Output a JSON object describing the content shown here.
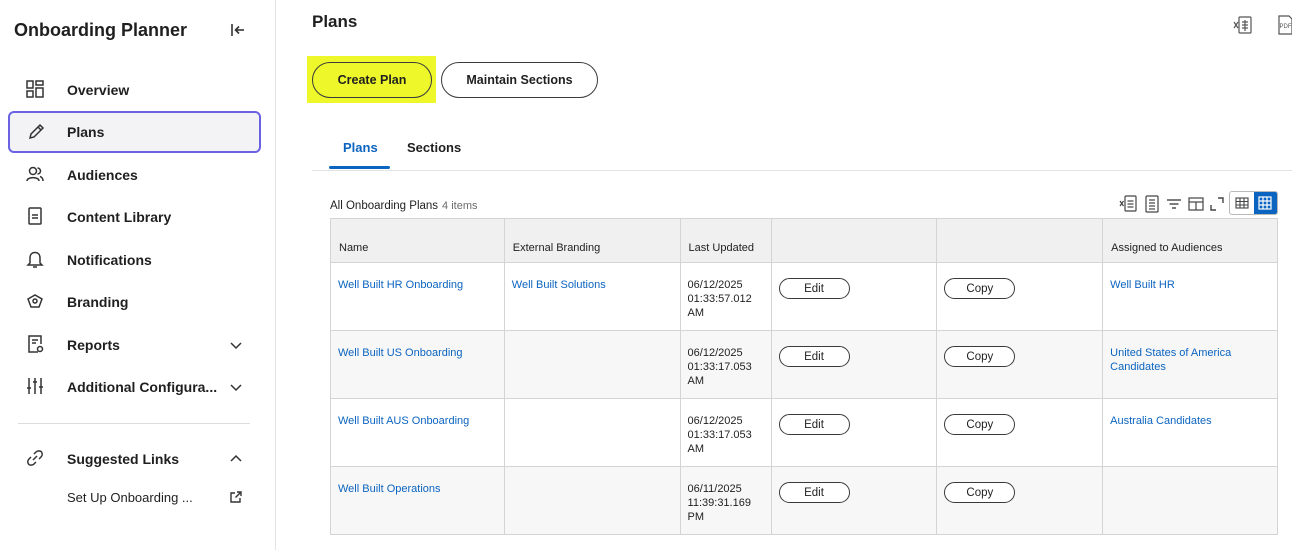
{
  "sidebar": {
    "title": "Onboarding Planner",
    "items": [
      {
        "label": "Overview",
        "icon": "grid-icon"
      },
      {
        "label": "Plans",
        "icon": "pencil-icon"
      },
      {
        "label": "Audiences",
        "icon": "people-icon"
      },
      {
        "label": "Content Library",
        "icon": "document-icon"
      },
      {
        "label": "Notifications",
        "icon": "bell-icon"
      },
      {
        "label": "Branding",
        "icon": "branding-icon"
      },
      {
        "label": "Reports",
        "icon": "report-icon"
      },
      {
        "label": "Additional Configura...",
        "icon": "sliders-icon"
      }
    ],
    "suggested_links": {
      "label": "Suggested Links",
      "items": [
        "Set Up Onboarding ..."
      ]
    }
  },
  "main": {
    "title": "Plans",
    "buttons": {
      "create": "Create Plan",
      "maintain": "Maintain Sections"
    },
    "tabs": [
      "Plans",
      "Sections"
    ],
    "active_tab": "Plans",
    "grid": {
      "caption": "All Onboarding Plans",
      "count": "4 items",
      "columns": [
        "Name",
        "External Branding",
        "Last Updated",
        "",
        "",
        "Assigned to Audiences"
      ],
      "edit_label": "Edit",
      "copy_label": "Copy",
      "rows": [
        {
          "name": "Well Built HR Onboarding",
          "branding": "Well Built Solutions",
          "updated_date": "06/12/2025",
          "updated_time": "01:33:57.012",
          "updated_ampm": "AM",
          "audiences": [
            "Well Built HR"
          ]
        },
        {
          "name": "Well Built US Onboarding",
          "branding": "",
          "updated_date": "06/12/2025",
          "updated_time": "01:33:17.053",
          "updated_ampm": "AM",
          "audiences": [
            "United States of America",
            "Candidates"
          ]
        },
        {
          "name": "Well Built AUS Onboarding",
          "branding": "",
          "updated_date": "06/12/2025",
          "updated_time": "01:33:17.053",
          "updated_ampm": "AM",
          "audiences": [
            "Australia Candidates"
          ]
        },
        {
          "name": "Well Built Operations",
          "branding": "",
          "updated_date": "06/11/2025",
          "updated_time": "11:39:31.169",
          "updated_ampm": "PM",
          "audiences": []
        }
      ]
    }
  },
  "colors": {
    "accent": "#0b64c0",
    "highlight": "#edf72a",
    "active_border": "#6a62e0"
  }
}
